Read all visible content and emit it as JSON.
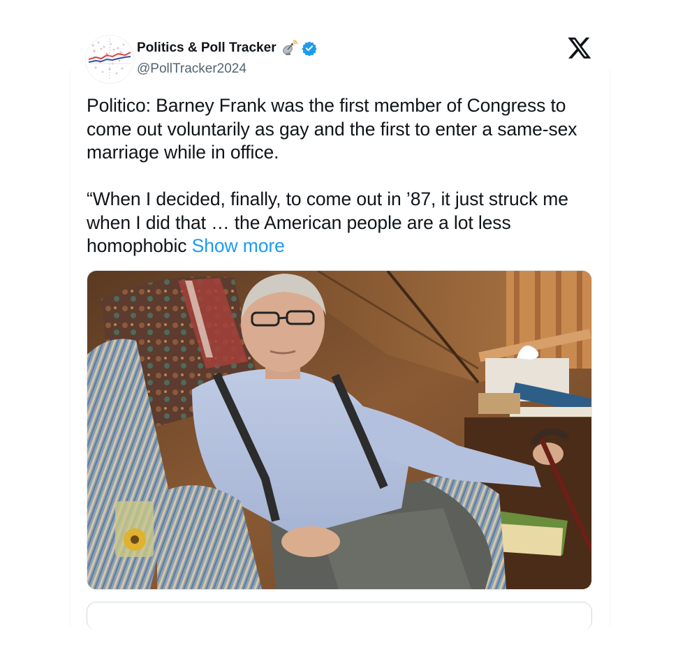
{
  "author": {
    "display_name": "Politics & Poll Tracker",
    "handle": "@PollTracker2024",
    "verified_color": "#1d9bf0",
    "icons": [
      "satellite-antenna-emoji",
      "verified-badge-icon"
    ]
  },
  "platform": {
    "logo": "x-logo-icon"
  },
  "tweet": {
    "paragraph1": "Politico: Barney Frank was the first member of Congress to come out voluntarily as gay and the first to enter a same-sex marriage while in office.",
    "paragraph2": "“When I decided, finally, to come out in ’87, it just struck me when I did that … the American people are a lot less homophobic",
    "show_more": "Show more",
    "link_color": "#1d9bf0"
  },
  "media": {
    "type": "photo",
    "subject": "older-man-seated-in-armchair"
  }
}
